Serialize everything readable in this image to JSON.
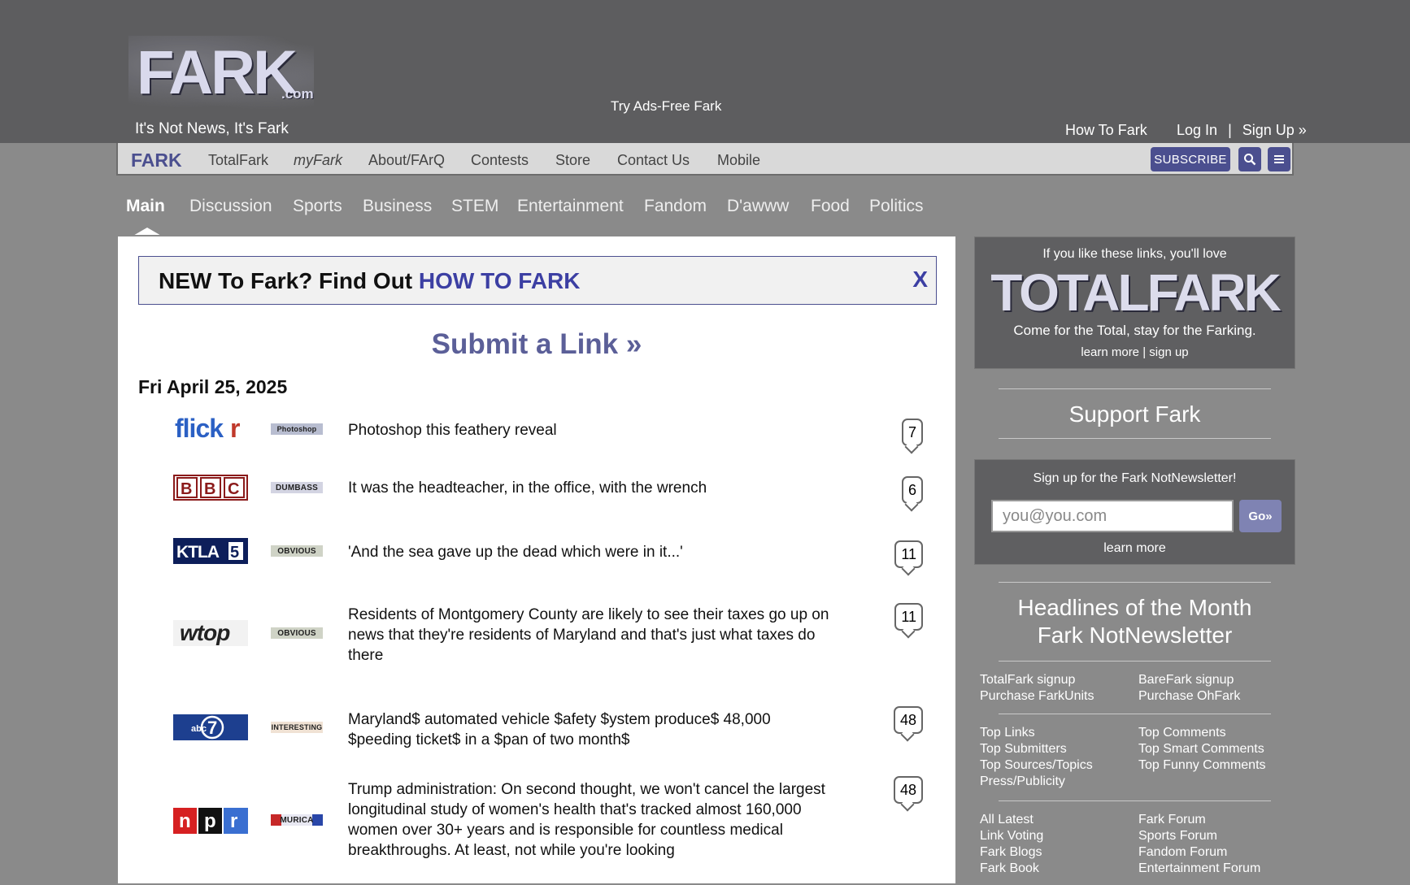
{
  "header": {
    "logo_text": "FARK",
    "logo_suffix": ".com",
    "tagline": "It's Not News, It's Fark",
    "ads_free": "Try Ads-Free Fark",
    "how_to": "How To Fark",
    "login": "Log In",
    "separator": "|",
    "signup": "Sign Up »"
  },
  "nav": {
    "brand": "FARK",
    "items": [
      "TotalFark",
      "myFark",
      "About/FArQ",
      "Contests",
      "Store",
      "Contact Us",
      "Mobile"
    ],
    "subscribe": "SUBSCRIBE",
    "search_icon": "search-icon",
    "menu_icon": "menu-icon"
  },
  "tabs": [
    "Main",
    "Discussion",
    "Sports",
    "Business",
    "STEM",
    "Entertainment",
    "Fandom",
    "D'awww",
    "Food",
    "Politics"
  ],
  "banner": {
    "text": "NEW To Fark? Find Out ",
    "link": "HOW TO FARK",
    "close": "X"
  },
  "submit_link": "Submit a Link »",
  "date": "Fri April 25, 2025",
  "links": [
    {
      "source": "flickr",
      "tag": "Photoshop",
      "headline": "Photoshop this feathery reveal",
      "comments": "7"
    },
    {
      "source": "BBC",
      "tag": "DUMBASS",
      "headline": "It was the headteacher, in the office, with the wrench",
      "comments": "6"
    },
    {
      "source": "KTLA5",
      "tag": "OBVIOUS",
      "headline": "'And the sea gave up the dead which were in it...'",
      "comments": "11"
    },
    {
      "source": "wtop",
      "tag": "OBVIOUS",
      "headline": "Residents of Montgomery County are likely to see their taxes go up on news that they're residents of Maryland and that's just what taxes do there",
      "comments": "11"
    },
    {
      "source": "abc7",
      "tag": "INTERESTING",
      "headline": "Maryland$ automated vehicle $afety $ystem produce$ 48,000 $peeding ticket$ in a $pan of two month$",
      "comments": "48"
    },
    {
      "source": "npr",
      "tag": "MURICA",
      "headline": "Trump administration: On second thought, we won't cancel the largest longitudinal study of women's health that's tracked almost 160,000 women over 30+ years and is responsible for countless medical breakthroughs. At least, not while you're looking",
      "comments": "48"
    }
  ],
  "sidebar": {
    "tf_top": "If you like these links, you'll love",
    "tf_logo": "TOTALFARK",
    "tf_come": "Come for the Total, stay for the Farking.",
    "tf_learn": "learn more",
    "tf_sep": "|",
    "tf_signup": "sign up",
    "support": "Support Fark",
    "nl_title": "Sign up for the Fark NotNewsletter!",
    "email_placeholder": "you@you.com",
    "go": "Go»",
    "nl_learn": "learn more",
    "hotm_1": "Headlines of the Month",
    "hotm_2": "Fark NotNewsletter",
    "col1_a": [
      "TotalFark signup",
      "Purchase FarkUnits"
    ],
    "col2_a": [
      "BareFark signup",
      "Purchase OhFark"
    ],
    "col1_b": [
      "Top Links",
      "Top Submitters",
      "Top Sources/Topics",
      "Press/Publicity"
    ],
    "col2_b": [
      "Top Comments",
      "Top Smart Comments",
      "Top Funny Comments"
    ],
    "col1_c": [
      "All Latest",
      "Link Voting",
      "Fark Blogs",
      "Fark Book"
    ],
    "col2_c": [
      "Fark Forum",
      "Sports Forum",
      "Fandom Forum",
      "Entertainment Forum"
    ]
  },
  "colors": {
    "accent": "#4b4f8f",
    "link_blue": "#3c3fa3",
    "background": "#8a8a8a",
    "header_bg": "#5d5d5f"
  }
}
